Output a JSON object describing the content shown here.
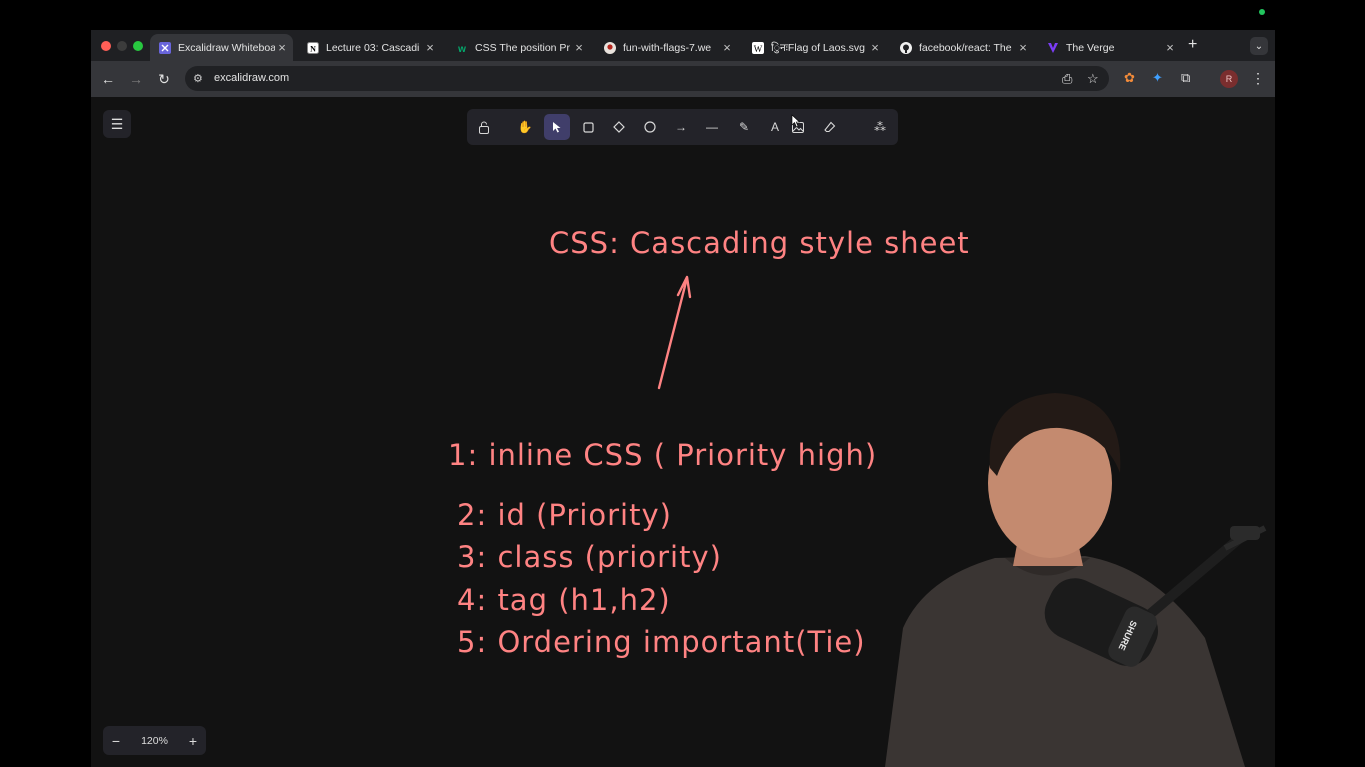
{
  "browser": {
    "tabs": [
      {
        "title": "Excalidraw Whiteboa",
        "icon": "excalidraw-icon",
        "active": true
      },
      {
        "title": "Lecture 03: Cascadi",
        "icon": "notion-icon",
        "active": false
      },
      {
        "title": "CSS The position Pr",
        "icon": "w3-icon",
        "active": false
      },
      {
        "title": "fun-with-flags-7.we",
        "icon": "avatar-icon",
        "active": false
      },
      {
        "title": "ुिनःFlag of Laos.svg",
        "icon": "wikipedia-icon",
        "active": false
      },
      {
        "title": "facebook/react: The",
        "icon": "github-icon",
        "active": false
      },
      {
        "title": "The Verge",
        "icon": "verge-icon",
        "active": false
      }
    ],
    "address": "excalidraw.com",
    "profile_initial": "R"
  },
  "excalidraw": {
    "zoom": "120%",
    "selected_tool": "selection",
    "tools": [
      "lock",
      "hand",
      "selection",
      "rectangle",
      "diamond",
      "ellipse",
      "arrow",
      "line",
      "draw",
      "text",
      "image",
      "eraser",
      "more-tools"
    ]
  },
  "canvas": {
    "heading": "CSS: Cascading style sheet",
    "item1": "1: inline CSS ( Priority high)",
    "item2": "2: id (Priority)",
    "item3": "3: class (priority)",
    "item4": "4: tag (h1,h2)",
    "item5": "5: Ordering important(Tie)",
    "ink_color": "#ff8383"
  },
  "mic_brand": "SHURE"
}
